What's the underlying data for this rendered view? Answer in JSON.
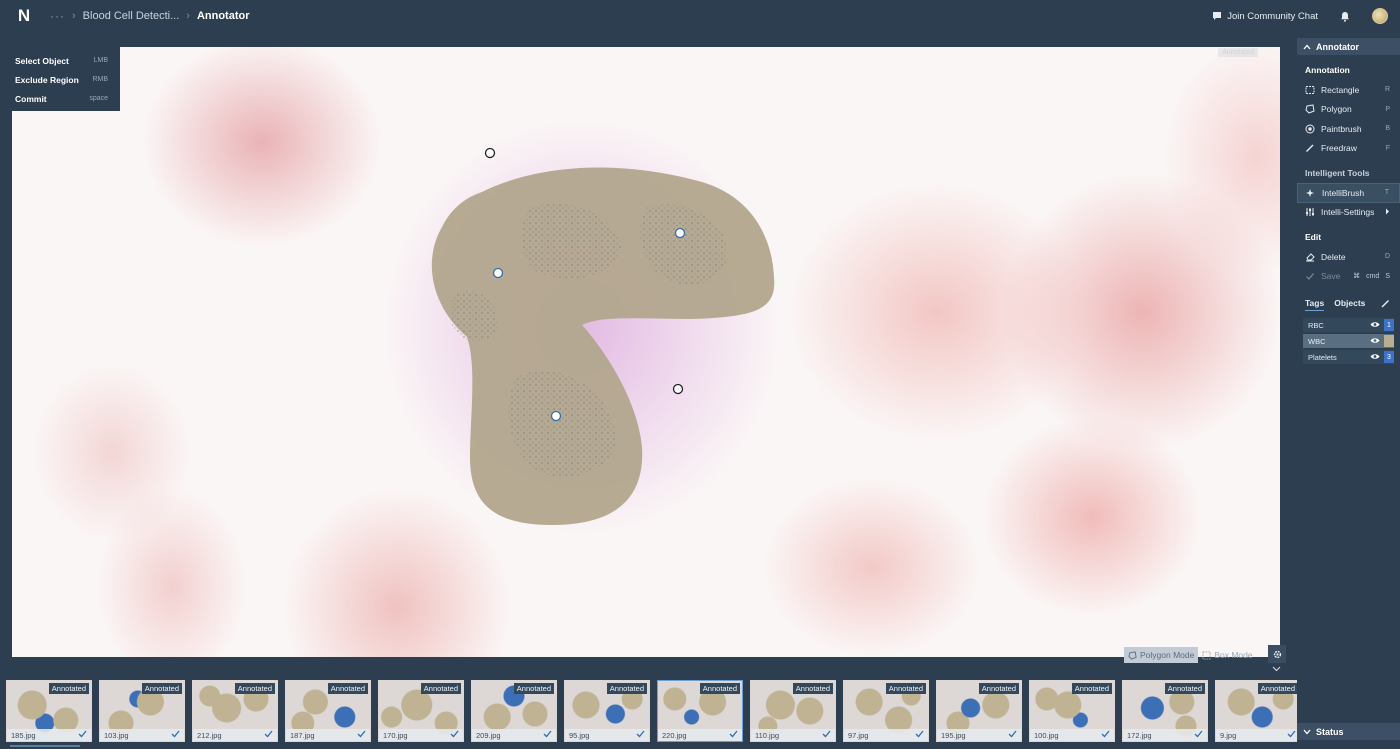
{
  "header": {
    "logo": "N",
    "breadcrumb_more": "···",
    "project": "Blood Cell Detecti...",
    "separator": "›",
    "current": "Annotator",
    "community": "Join Community Chat"
  },
  "hints": [
    {
      "label": "Select Object",
      "key": "LMB"
    },
    {
      "label": "Exclude Region",
      "key": "RMB"
    },
    {
      "label": "Commit",
      "key": "space"
    }
  ],
  "canvas": {
    "watermark": "Annotated",
    "polygon_mode": "Polygon Mode",
    "box_mode": "Box Mode"
  },
  "sidebar": {
    "title": "Annotator",
    "annotation_title": "Annotation",
    "annotation_tools": [
      {
        "label": "Rectangle",
        "key": "R"
      },
      {
        "label": "Polygon",
        "key": "P"
      },
      {
        "label": "Paintbrush",
        "key": "B"
      },
      {
        "label": "Freedraw",
        "key": "F"
      }
    ],
    "intelligent_title": "Intelligent Tools",
    "intellibrush": {
      "label": "IntelliBrush",
      "key": "T"
    },
    "intelli_settings": {
      "label": "Intelli-Settings"
    },
    "edit_title": "Edit",
    "delete": {
      "label": "Delete",
      "key": "D"
    },
    "save": {
      "label": "Save",
      "mod": "cmd",
      "key": "S"
    },
    "tabs": {
      "tags": "Tags",
      "objects": "Objects"
    },
    "tags": [
      {
        "name": "RBC",
        "num": "1",
        "color": "#3b73c8"
      },
      {
        "name": "WBC",
        "num": "",
        "color": "#b9ae92"
      },
      {
        "name": "Platelets",
        "num": "3",
        "color": "#3b73c8"
      }
    ],
    "status": "Status"
  },
  "filmstrip": {
    "badge": "Annotated",
    "items": [
      {
        "file": "185.jpg"
      },
      {
        "file": "103.jpg"
      },
      {
        "file": "212.jpg"
      },
      {
        "file": "187.jpg"
      },
      {
        "file": "170.jpg"
      },
      {
        "file": "209.jpg"
      },
      {
        "file": "95.jpg"
      },
      {
        "file": "220.jpg"
      },
      {
        "file": "110.jpg"
      },
      {
        "file": "97.jpg"
      },
      {
        "file": "195.jpg"
      },
      {
        "file": "100.jpg"
      },
      {
        "file": "172.jpg"
      },
      {
        "file": "9.jpg"
      }
    ],
    "selected_index": 7
  },
  "colors": {
    "background": "#2d3e50",
    "mask": "#b3a78f",
    "accent": "#6ea0d6"
  }
}
